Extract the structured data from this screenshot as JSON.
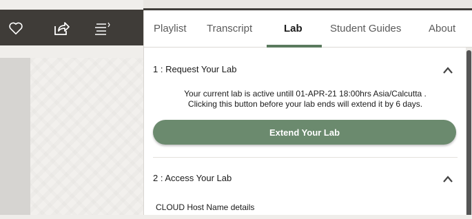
{
  "toolbar": {
    "icons": [
      "heart-icon",
      "share-icon",
      "menu-icon"
    ]
  },
  "tabs": [
    {
      "label": "Playlist",
      "active": false
    },
    {
      "label": "Transcript",
      "active": false
    },
    {
      "label": "Lab",
      "active": true
    },
    {
      "label": "Student Guides",
      "active": false
    },
    {
      "label": "About",
      "active": false
    }
  ],
  "lab": {
    "section1_title": "1 : Request Your Lab",
    "active_line": "Your current lab is active untill 01-APR-21 18:00hrs Asia/Calcutta .",
    "extend_line": "Clicking this button before your lab ends will extend it by 6 days.",
    "extend_button": "Extend Your Lab",
    "section2_title": "2 : Access Your Lab",
    "cloud_label": "CLOUD Host Name details"
  },
  "colors": {
    "toolbar_bg": "#3f3c38",
    "accent_green": "#6b8a6e",
    "tab_underline": "#5a7a5e"
  }
}
